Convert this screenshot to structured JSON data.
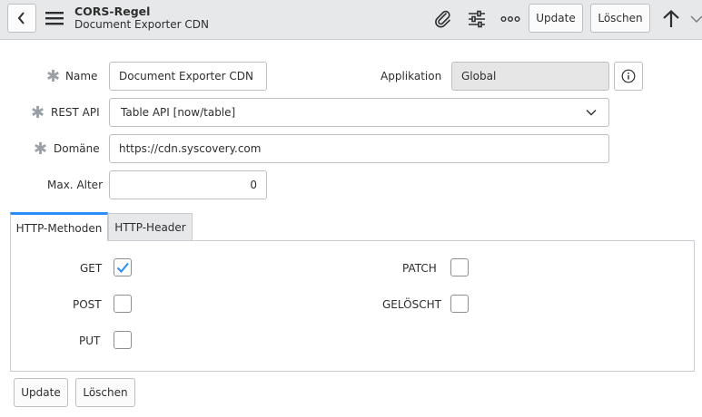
{
  "header": {
    "title": "CORS-Regel",
    "subtitle": "Document Exporter CDN",
    "update_label": "Update",
    "delete_label": "Löschen",
    "icons": [
      "back-icon",
      "hamburger-menu-icon",
      "paperclip-icon",
      "sliders-icon",
      "more-icon",
      "arrow-up-icon",
      "chevron-down-icon"
    ]
  },
  "form": {
    "name_label": "Name",
    "name_value": "Document Exporter CDN",
    "app_label": "Applikation",
    "app_value": "Global",
    "rest_api_label": "REST API",
    "rest_api_value": "Table API [now/table]",
    "domain_label": "Domäne",
    "domain_value": "https://cdn.syscovery.com",
    "max_age_label": "Max. Alter",
    "max_age_value": "0",
    "required_marker": "✱"
  },
  "tabs": [
    {
      "label": "HTTP-Methoden",
      "active": true
    },
    {
      "label": "HTTP-Header",
      "active": false
    }
  ],
  "methods": {
    "get": {
      "label": "GET",
      "checked": true
    },
    "post": {
      "label": "POST",
      "checked": false
    },
    "put": {
      "label": "PUT",
      "checked": false
    },
    "patch": {
      "label": "PATCH",
      "checked": false
    },
    "delete": {
      "label": "GELÖSCHT",
      "checked": false
    }
  },
  "footer": {
    "update_label": "Update",
    "delete_label": "Löschen"
  },
  "colors": {
    "accent": "#278efc",
    "header_bg": "#e6e8ea",
    "readonly_bg": "#e6e6e6"
  }
}
